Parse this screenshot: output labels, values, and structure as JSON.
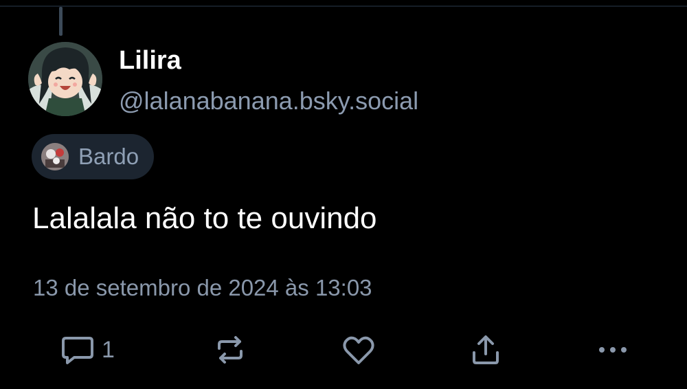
{
  "post": {
    "author": {
      "display_name": "Lilira",
      "handle": "@lalanabanana.bsky.social",
      "avatar_icon": "anime-girl-avatar"
    },
    "label": {
      "text": "Bardo",
      "icon": "labeler-avatar"
    },
    "text": "Lalalala não to te ouvindo",
    "timestamp": "13 de setembro de 2024 às 13:03",
    "actions": {
      "reply_count": "1",
      "reply_icon": "reply-icon",
      "repost_icon": "repost-icon",
      "like_icon": "heart-icon",
      "share_icon": "share-icon",
      "more_icon": "more-icon"
    }
  },
  "colors": {
    "background": "#000000",
    "secondary_text": "#8a98ab",
    "chip_background": "#1c2530",
    "icon": "#8a98ab"
  }
}
